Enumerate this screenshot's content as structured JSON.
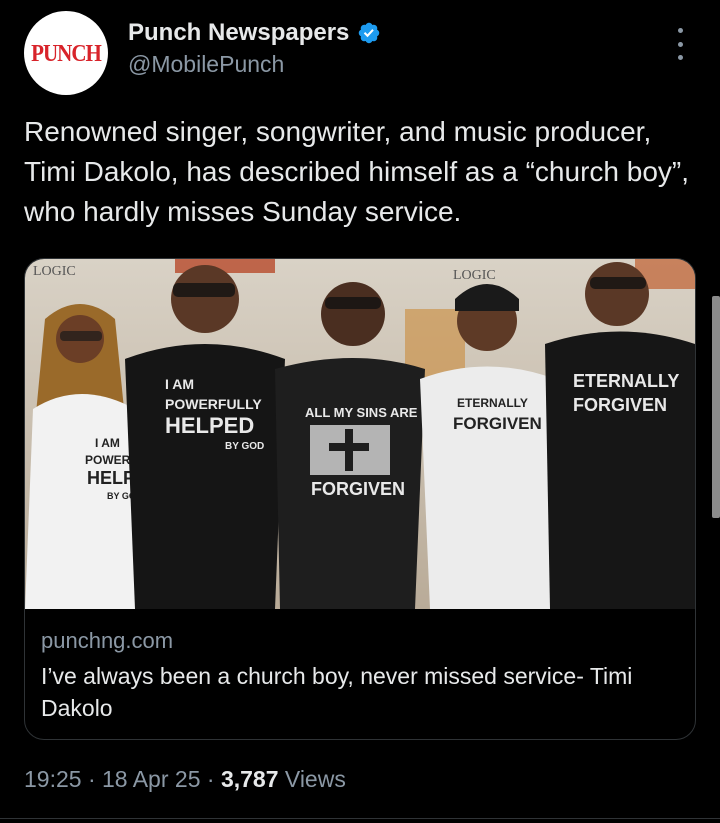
{
  "author": {
    "display_name": "Punch Newspapers",
    "handle": "@MobilePunch",
    "avatar_text": "PUNCH",
    "verified": true
  },
  "tweet": {
    "text": "Renowned singer, songwriter, and music producer, Timi Dakolo, has described himself as a “church boy”, who hardly misses Sunday service."
  },
  "card": {
    "domain": "punchng.com",
    "title": "I’ve always been a church boy, never missed service- Timi Dakolo",
    "image_texts": {
      "banner_left": "LOGIC",
      "banner_right": "LOGIC",
      "shirt1_l1": "I AM",
      "shirt1_l2": "POWERFULLY",
      "shirt1_l3": "HELPED",
      "shirt1_l4": "BY GOD",
      "shirt2_l1": "I AM",
      "shirt2_l2": "POWERFULLY",
      "shirt2_l3": "HELPED",
      "shirt2_l4": "BY GOD",
      "shirt3_l1": "ALL MY SINS ARE",
      "shirt3_l2": "FORGIVEN",
      "shirt4_l1": "ETERNALLY",
      "shirt4_l2": "FORGIVEN",
      "shirt5_l1": "ETERNALLY",
      "shirt5_l2": "FORGIVEN"
    }
  },
  "meta": {
    "time": "19:25",
    "date": "18 Apr 25",
    "views_count": "3,787",
    "views_label": "Views"
  },
  "colors": {
    "background": "#000000",
    "text_primary": "#e7e9ea",
    "text_secondary": "#8b98a5",
    "verified_blue": "#1d9bf0",
    "punch_red": "#d8232a"
  },
  "icons": [
    "verified-badge-icon",
    "more-options-icon"
  ]
}
